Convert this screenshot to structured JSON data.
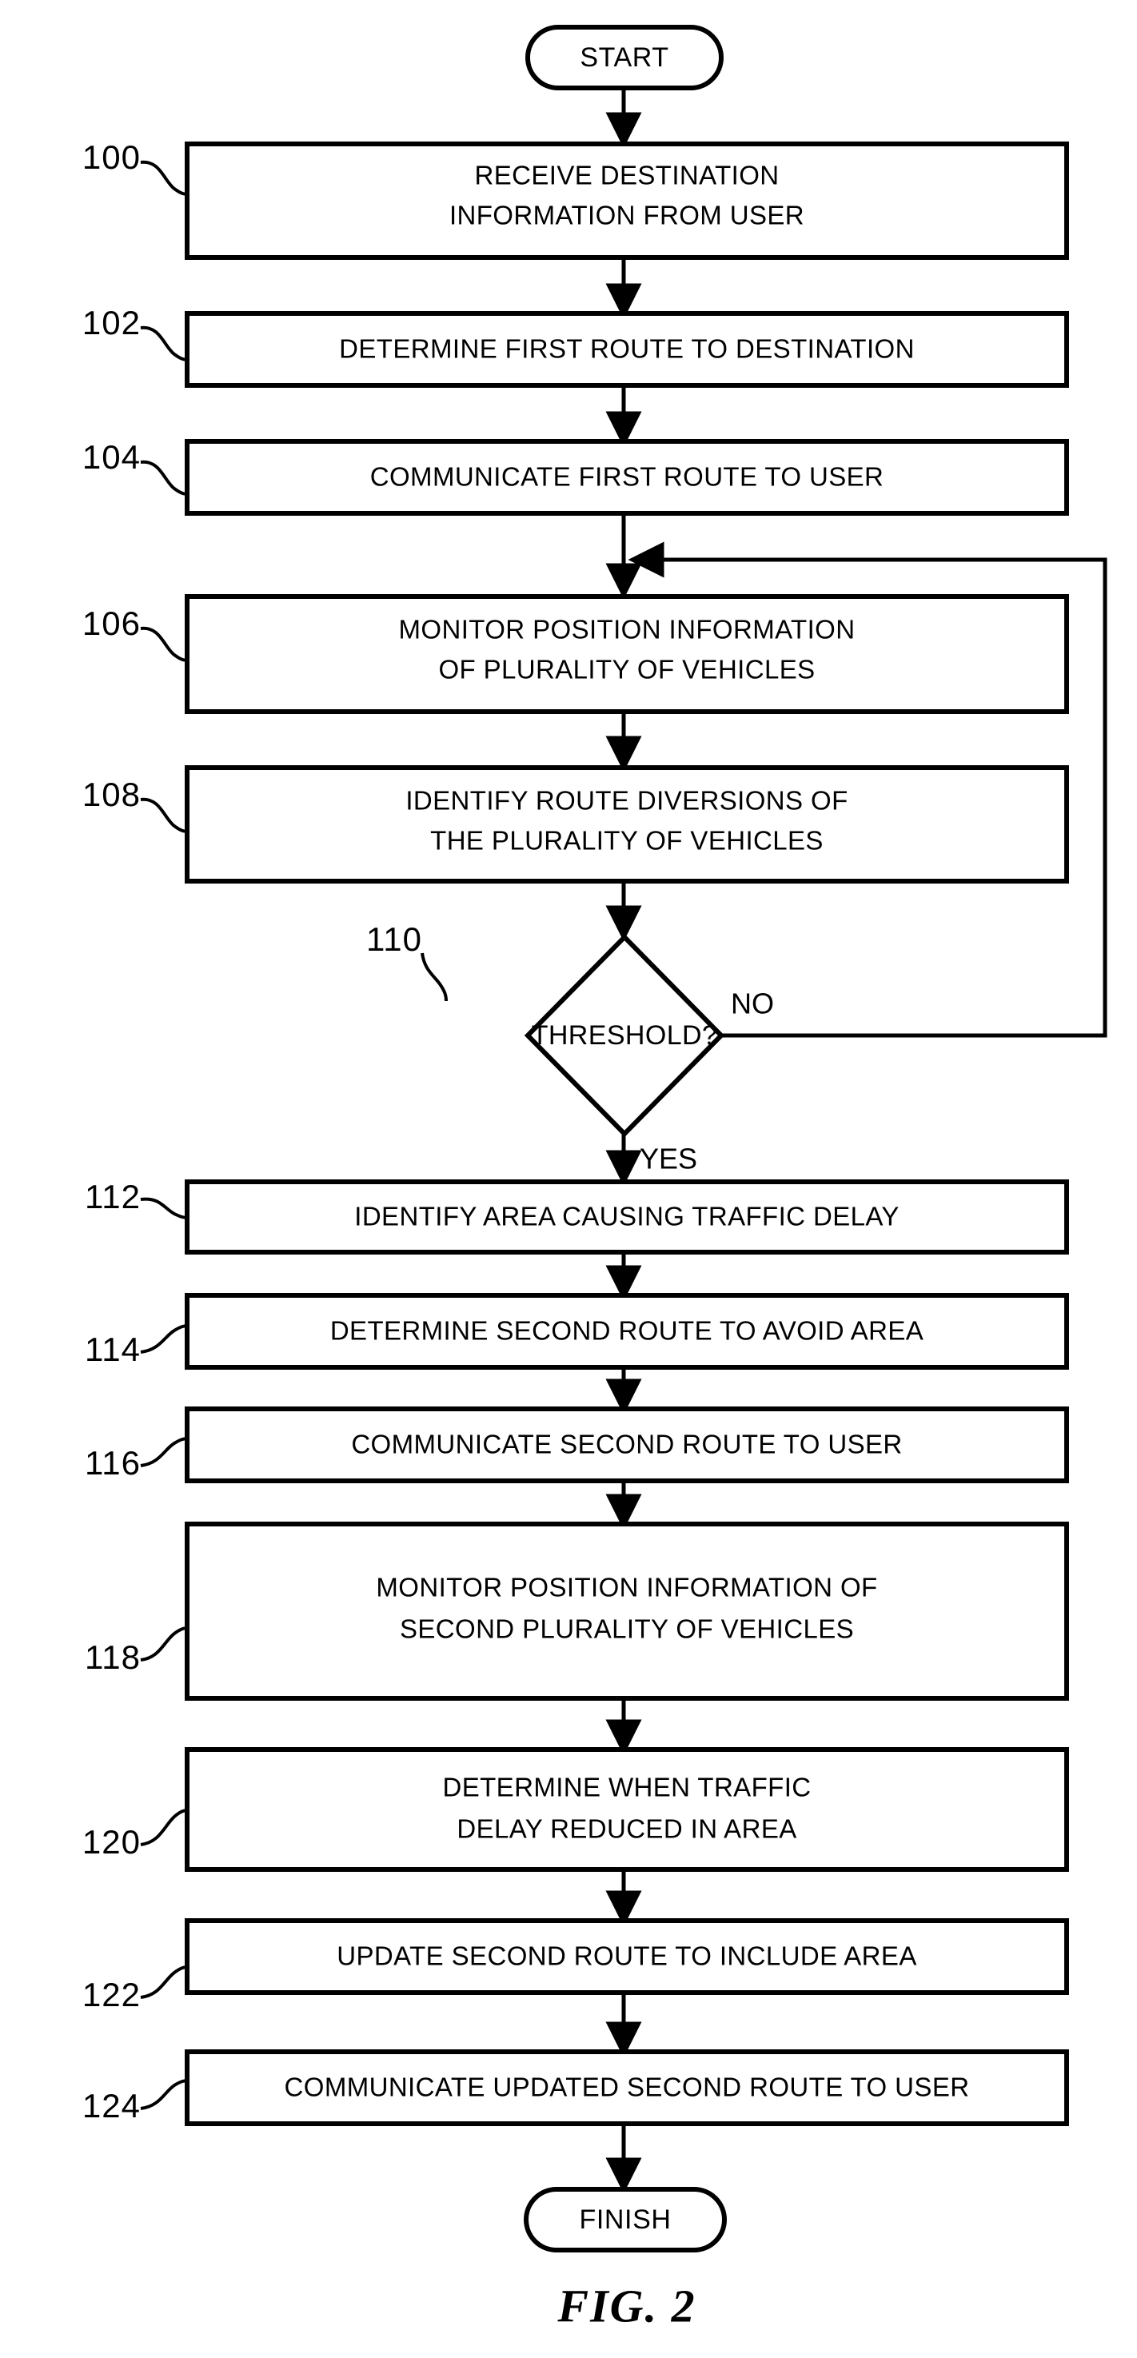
{
  "figure": {
    "caption": "FIG. 2",
    "title": "Traffic-aware route determination flowchart"
  },
  "terminators": {
    "start": {
      "label": "START",
      "ref": ""
    },
    "finish": {
      "label": "FINISH",
      "ref": ""
    }
  },
  "decision": {
    "ref": "110",
    "label": "THRESHOLD?",
    "yes_label": "YES",
    "no_label": "NO"
  },
  "steps": [
    {
      "ref": "100",
      "lines": [
        "RECEIVE DESTINATION",
        "INFORMATION FROM USER"
      ]
    },
    {
      "ref": "102",
      "lines": [
        "DETERMINE FIRST ROUTE TO DESTINATION"
      ]
    },
    {
      "ref": "104",
      "lines": [
        "COMMUNICATE FIRST ROUTE TO USER"
      ]
    },
    {
      "ref": "106",
      "lines": [
        "MONITOR POSITION INFORMATION",
        "OF PLURALITY OF VEHICLES"
      ]
    },
    {
      "ref": "108",
      "lines": [
        "IDENTIFY ROUTE DIVERSIONS OF",
        "THE PLURALITY OF VEHICLES"
      ]
    },
    {
      "ref": "112",
      "lines": [
        "IDENTIFY AREA CAUSING TRAFFIC DELAY"
      ]
    },
    {
      "ref": "114",
      "lines": [
        "DETERMINE SECOND ROUTE TO AVOID AREA"
      ]
    },
    {
      "ref": "116",
      "lines": [
        "COMMUNICATE SECOND ROUTE TO USER"
      ]
    },
    {
      "ref": "118",
      "lines": [
        "MONITOR POSITION INFORMATION OF",
        "SECOND PLURALITY OF VEHICLES"
      ]
    },
    {
      "ref": "120",
      "lines": [
        "DETERMINE WHEN TRAFFIC",
        "DELAY REDUCED IN AREA"
      ]
    },
    {
      "ref": "122",
      "lines": [
        "UPDATE SECOND ROUTE TO INCLUDE AREA"
      ]
    },
    {
      "ref": "124",
      "lines": [
        "COMMUNICATE UPDATED SECOND ROUTE TO USER"
      ]
    }
  ],
  "colors": {
    "ink": "#000000",
    "paper": "#ffffff"
  }
}
